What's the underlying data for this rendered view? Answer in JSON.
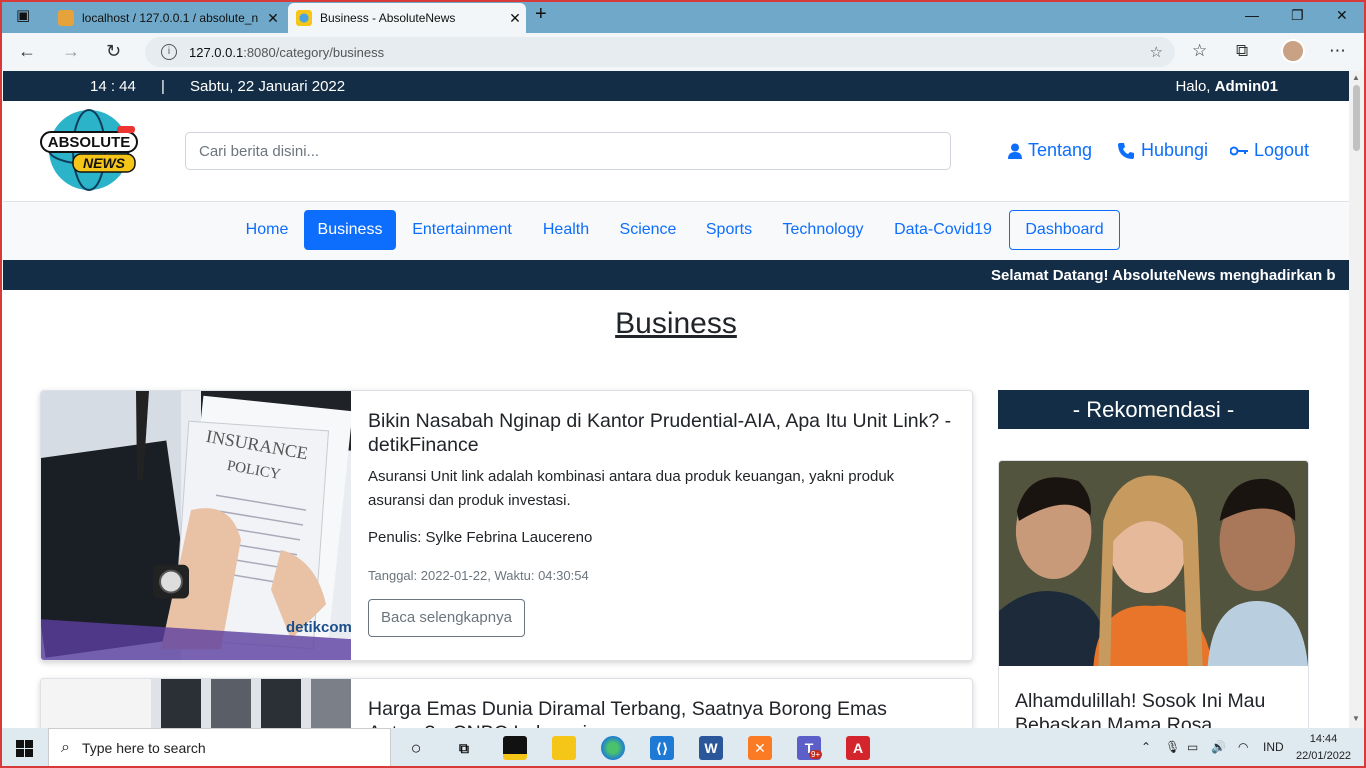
{
  "browser": {
    "tabs": [
      {
        "title": "localhost / 127.0.0.1 / absolute_n",
        "active": false
      },
      {
        "title": "Business - AbsoluteNews",
        "active": true
      }
    ],
    "url_host": "127.0.0.1",
    "url_rest": ":8080/category/business"
  },
  "topbar": {
    "time": "14 : 44",
    "separator": "|",
    "date": "Sabtu, 22 Januari 2022",
    "greeting": "Halo, ",
    "user": "Admin01"
  },
  "header": {
    "logo_top": "ABSOLUTE",
    "logo_bottom": "NEWS",
    "search_placeholder": "Cari berita disini...",
    "links": [
      {
        "label": "Tentang",
        "icon": "user-icon"
      },
      {
        "label": "Hubungi",
        "icon": "phone-icon"
      },
      {
        "label": "Logout",
        "icon": "key-icon"
      }
    ]
  },
  "nav": {
    "items": [
      "Home",
      "Business",
      "Entertainment",
      "Health",
      "Science",
      "Sports",
      "Technology",
      "Data-Covid19",
      "Dashboard"
    ],
    "active": "Business"
  },
  "marquee": "Selamat Datang! AbsoluteNews menghadirkan b",
  "page_title": "Business",
  "articles": [
    {
      "title": "Bikin Nasabah Nginap di Kantor Prudential-AIA, Apa Itu Unit Link? - detikFinance",
      "description": "Asuransi Unit link adalah kombinasi antara dua produk keuangan, yakni produk asuransi dan produk investasi.",
      "author": "Penulis: Sylke Febrina Laucereno",
      "meta": "Tanggal: 2022-01-22, Waktu: 04:30:54",
      "button": "Baca selengkapnya",
      "image_text_1": "INSURANCE",
      "image_text_2": "POLICY",
      "image_brand": "detikcom"
    },
    {
      "title": "Harga Emas Dunia Diramal Terbang, Saatnya Borong Emas Antam? - CNBC Indonesia"
    }
  ],
  "sidebar": {
    "heading": "- Rekomendasi -",
    "card_title": "Alhamdulillah! Sosok Ini Mau Bebaskan Mama Rosa,"
  },
  "taskbar": {
    "search_placeholder": "Type here to search",
    "lang": "IND",
    "time": "14:44",
    "date": "22/01/2022",
    "teams_badge": "9+"
  },
  "colors": {
    "navy": "#142d46",
    "primary": "#0d6efd",
    "browser_tabbar": "#6fa8c8"
  }
}
